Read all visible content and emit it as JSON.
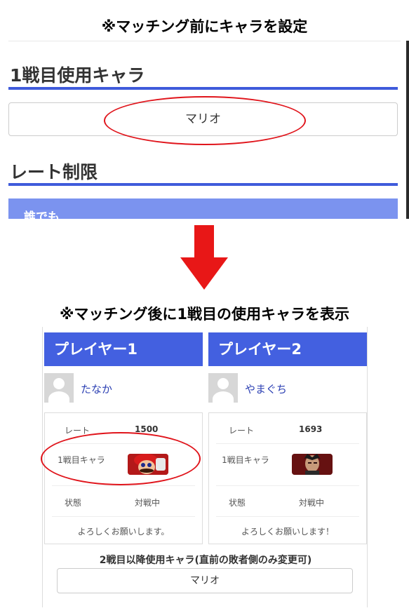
{
  "captions": {
    "before": "※マッチング前にキャラを設定",
    "after": "※マッチング後に1戦目の使用キャラを表示"
  },
  "settings": {
    "first_char_title": "1戦目使用キャラ",
    "first_char_value": "マリオ",
    "rate_limit_title": "レート制限",
    "rate_limit_option": "誰でも"
  },
  "players": [
    {
      "header": "プレイヤー1",
      "name": "たなか",
      "rate_label": "レート",
      "rate_value": "1500",
      "char_label": "1戦目キャラ",
      "char_icon": "mario-portrait",
      "status_label": "状態",
      "status_value": "対戦中",
      "message": "よろしくお願いします。"
    },
    {
      "header": "プレイヤー2",
      "name": "やまぐち",
      "rate_label": "レート",
      "rate_value": "1693",
      "char_label": "1戦目キャラ",
      "char_icon": "kazuya-portrait",
      "status_label": "状態",
      "status_value": "対戦中",
      "message": "よろしくお願いします！"
    }
  ],
  "later": {
    "title": "2戦目以降使用キャラ(直前の敗者側のみ変更可)",
    "value": "マリオ"
  },
  "colors": {
    "accent": "#4360e0",
    "highlight_oval": "#e0141b",
    "arrow": "#e81717",
    "rate_option_bg": "#7b93ef"
  }
}
